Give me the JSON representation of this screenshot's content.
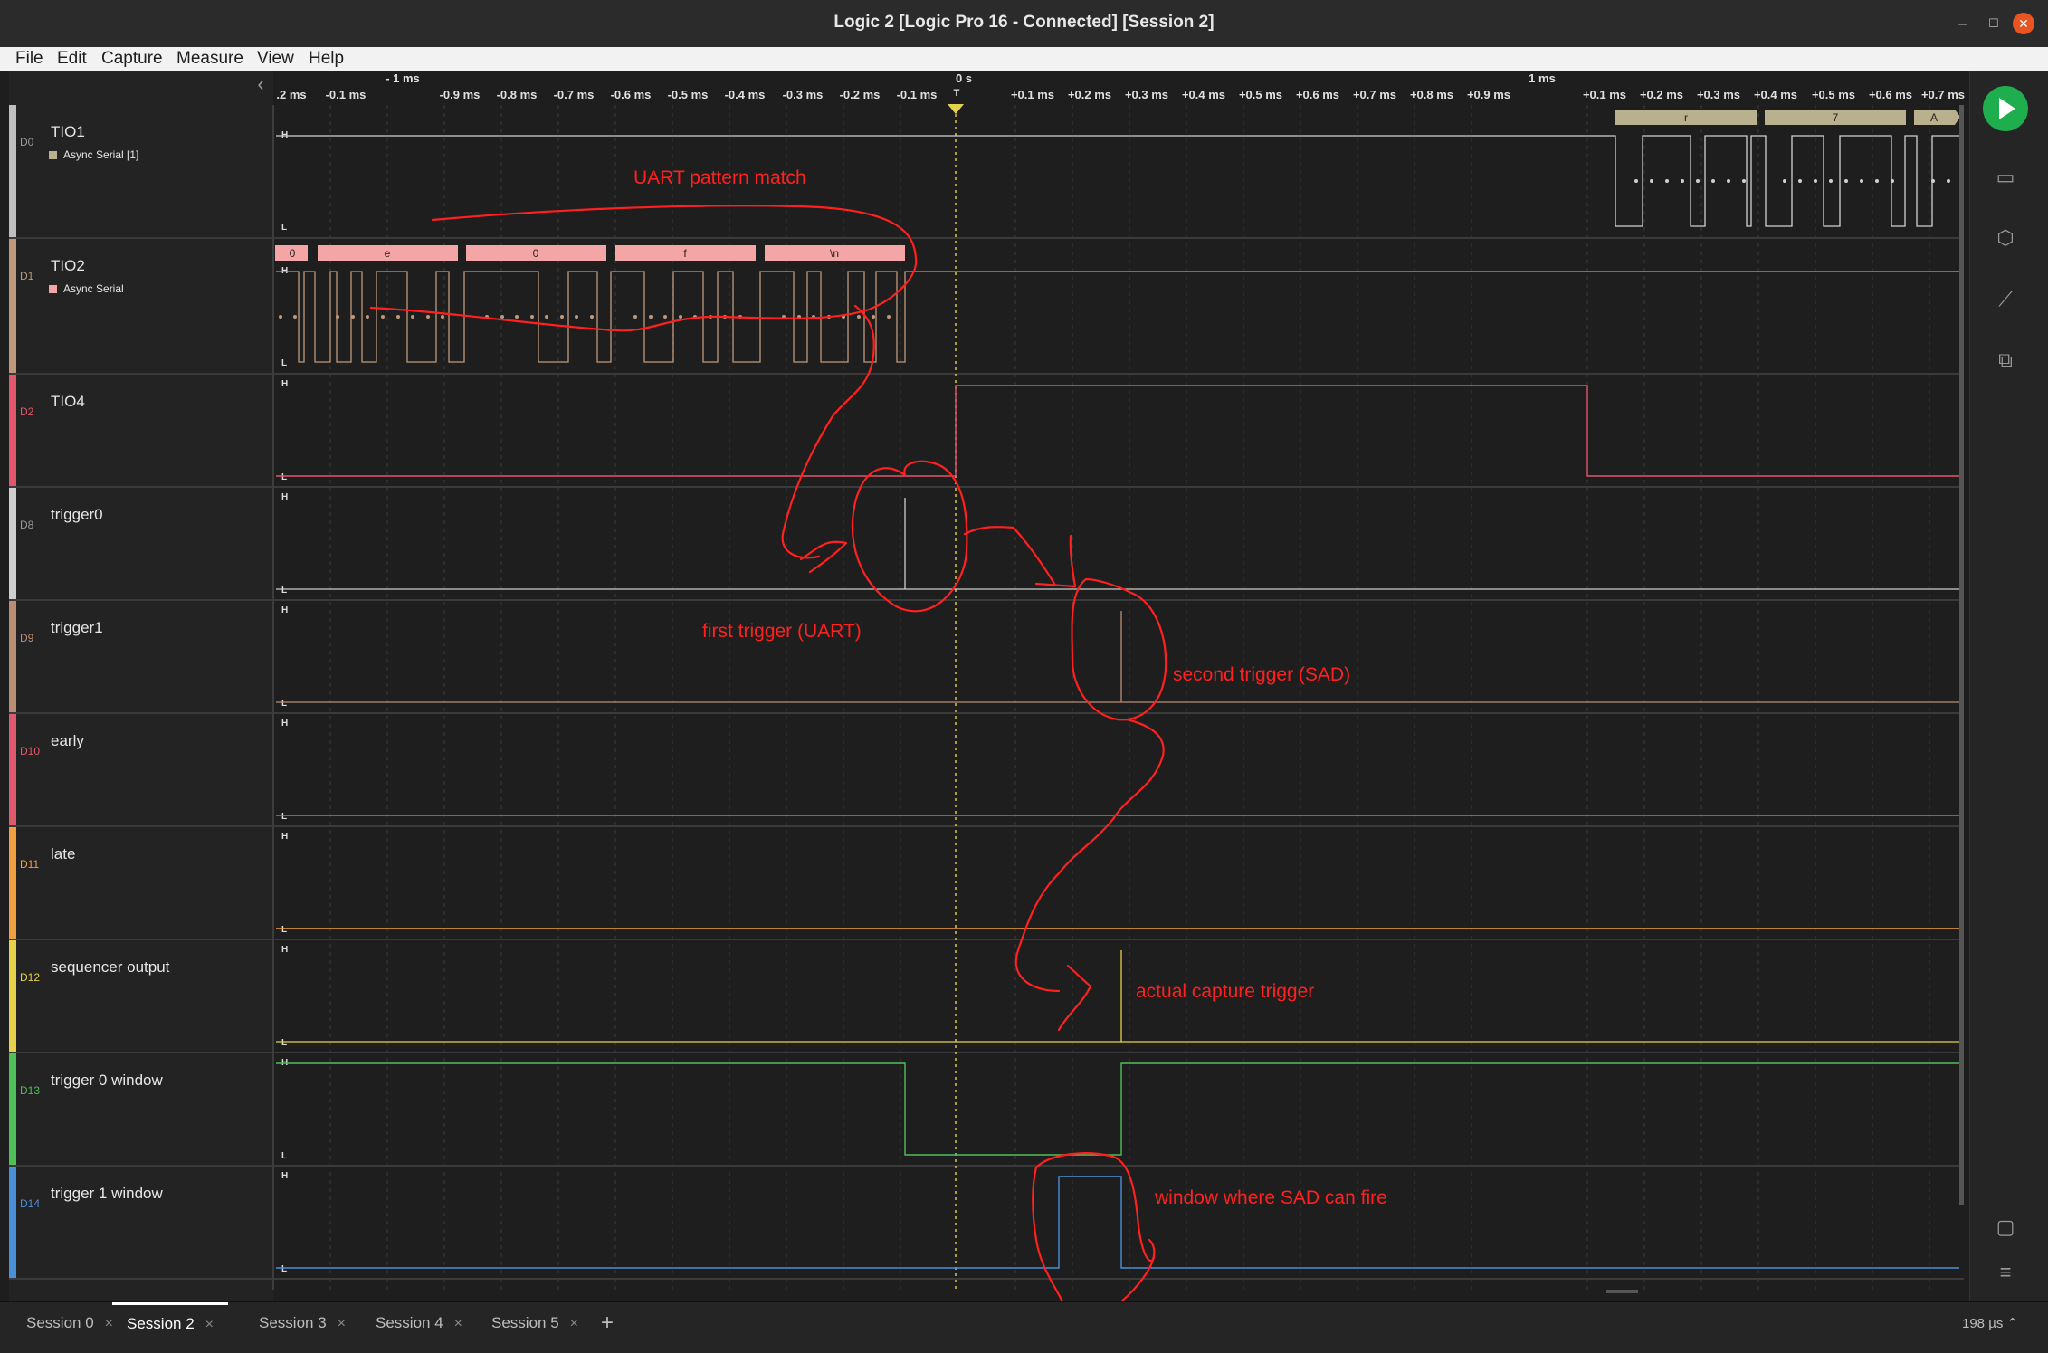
{
  "window": {
    "title": "Logic 2 [Logic Pro 16 - Connected] [Session 2]"
  },
  "menu": [
    "File",
    "Edit",
    "Capture",
    "Measure",
    "View",
    "Help"
  ],
  "ruler": {
    "minor_labels": [
      ".2 ms",
      "-0.1 ms",
      "-0.9 ms",
      "-0.8 ms",
      "-0.7 ms",
      "-0.6 ms",
      "-0.5 ms",
      "-0.4 ms",
      "-0.3 ms",
      "-0.2 ms",
      "-0.1 ms",
      "+0.1 ms",
      "+0.2 ms",
      "+0.3 ms",
      "+0.4 ms",
      "+0.5 ms",
      "+0.6 ms",
      "+0.7 ms",
      "+0.8 ms",
      "+0.9 ms",
      "+0.1 ms",
      "+0.2 ms",
      "+0.3 ms",
      "+0.4 ms",
      "+0.5 ms",
      "+0.6 ms",
      "+0.7 ms"
    ],
    "major_labels": [
      "- 1 ms",
      "0 s",
      "1 ms"
    ],
    "trigger_label": "T"
  },
  "channels": [
    {
      "index": "D0",
      "name": "TIO1",
      "analyzer": "Async Serial [1]",
      "color": "#bfbfbf",
      "analyzer_color": "#b9b08e"
    },
    {
      "index": "D1",
      "name": "TIO2",
      "analyzer": "Async Serial",
      "color": "#bf9a7a",
      "analyzer_color": "#f4a6a6"
    },
    {
      "index": "D2",
      "name": "TIO4",
      "analyzer": "",
      "color": "#e0566a"
    },
    {
      "index": "D8",
      "name": "trigger0",
      "analyzer": "",
      "color": "#cfcfcf"
    },
    {
      "index": "D9",
      "name": "trigger1",
      "analyzer": "",
      "color": "#b98f74"
    },
    {
      "index": "D10",
      "name": "early",
      "analyzer": "",
      "color": "#e05a6f"
    },
    {
      "index": "D11",
      "name": "late",
      "analyzer": "",
      "color": "#f0a040"
    },
    {
      "index": "D12",
      "name": "sequencer output",
      "analyzer": "",
      "color": "#e5d24a"
    },
    {
      "index": "D13",
      "name": "trigger 0 window",
      "analyzer": "",
      "color": "#4fbf5a"
    },
    {
      "index": "D14",
      "name": "trigger 1 window",
      "analyzer": "",
      "color": "#4a90d9"
    }
  ],
  "level_labels": {
    "high": "H",
    "low": "L"
  },
  "decoded": {
    "tio1": [
      "r",
      "7",
      "A"
    ],
    "tio2": [
      "0",
      "e",
      "0",
      "f",
      "\\n"
    ]
  },
  "annotations": {
    "uart_pattern": "UART pattern match",
    "first_trigger": "first trigger (UART)",
    "second_trigger": "second trigger (SAD)",
    "actual_capture": "actual capture trigger",
    "sad_window": "window where SAD can fire"
  },
  "annotation_color": "#ff2020",
  "tabs": [
    {
      "label": "Session 0",
      "active": false
    },
    {
      "label": "Session 2",
      "active": true
    },
    {
      "label": "Session 3",
      "active": false
    },
    {
      "label": "Session 4",
      "active": false
    },
    {
      "label": "Session 5",
      "active": false
    }
  ],
  "zoom": "198 µs",
  "toolbar_icons": [
    "run-icon",
    "analyzers-icon",
    "extensions-icon",
    "measure-icon",
    "layout-icon",
    "comment-icon",
    "menu-icon"
  ]
}
